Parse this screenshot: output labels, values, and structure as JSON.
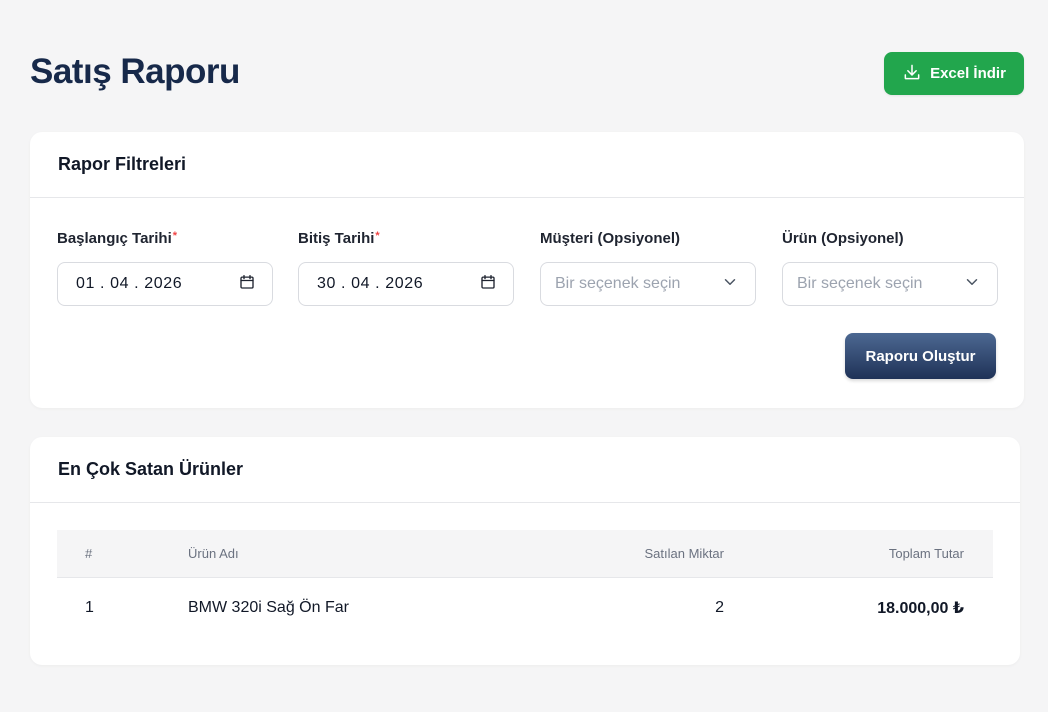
{
  "page": {
    "title": "Satış Raporu"
  },
  "toolbar": {
    "excel_label": "Excel İndir"
  },
  "filters": {
    "title": "Rapor Filtreleri",
    "start_date": {
      "label": "Başlangıç Tarihi",
      "required_mark": "*",
      "value": "01 . 04 . 2026"
    },
    "end_date": {
      "label": "Bitiş Tarihi",
      "required_mark": "*",
      "value": "30 . 04 . 2026"
    },
    "customer": {
      "label": "Müşteri (Opsiyonel)",
      "placeholder": "Bir seçenek seçin"
    },
    "product": {
      "label": "Ürün (Opsiyonel)",
      "placeholder": "Bir seçenek seçin"
    },
    "generate_label": "Raporu Oluştur"
  },
  "top_products": {
    "title": "En Çok Satan Ürünler",
    "columns": [
      "#",
      "Ürün Adı",
      "Satılan Miktar",
      "Toplam Tutar"
    ],
    "rows": [
      {
        "index": "1",
        "name": "BMW 320i Sağ Ön Far",
        "quantity": "2",
        "total": "18.000,00 ₺"
      }
    ]
  },
  "colors": {
    "accent_green": "#22a64d",
    "title_navy": "#17294a",
    "button_navy": "#1f3257"
  }
}
